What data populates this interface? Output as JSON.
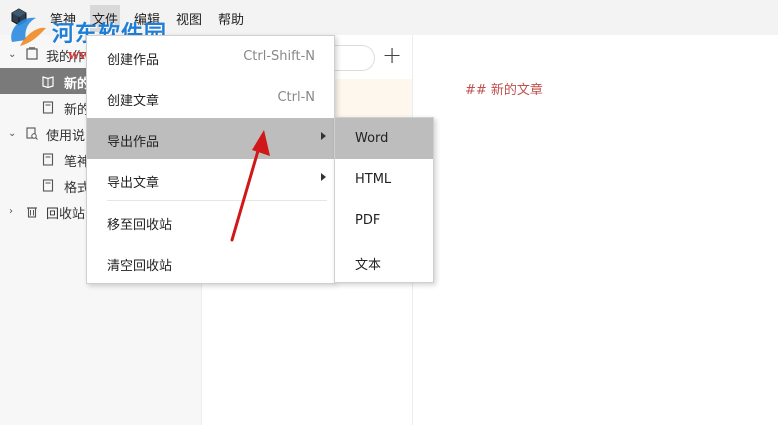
{
  "menubar": {
    "items": [
      {
        "label": "笔神"
      },
      {
        "label": "文件"
      },
      {
        "label": "编辑"
      },
      {
        "label": "视图"
      },
      {
        "label": "帮助"
      }
    ]
  },
  "watermark": {
    "title": "河东软件园",
    "url": "www.pc0359.cn"
  },
  "sidebar": {
    "items": [
      {
        "label": "我的作品",
        "icon": "folder-stack-icon"
      },
      {
        "label": "新的作品",
        "icon": "book-icon"
      },
      {
        "label": "新的文章",
        "icon": "document-icon"
      },
      {
        "label": "使用说明",
        "icon": "search-doc-icon"
      },
      {
        "label": "笔神",
        "icon": "document-icon"
      },
      {
        "label": "格式",
        "icon": "document-icon"
      },
      {
        "label": "回收站",
        "icon": "trash-icon"
      }
    ]
  },
  "editor": {
    "content": "## 新的文章"
  },
  "file_menu": {
    "items": [
      {
        "label": "创建作品",
        "shortcut": "Ctrl-Shift-N"
      },
      {
        "label": "创建文章",
        "shortcut": "Ctrl-N"
      },
      {
        "label": "导出作品",
        "shortcut": ""
      },
      {
        "label": "导出文章",
        "shortcut": ""
      },
      {
        "label": "移至回收站",
        "shortcut": ""
      },
      {
        "label": "清空回收站",
        "shortcut": ""
      }
    ]
  },
  "export_submenu": {
    "items": [
      {
        "label": "Word"
      },
      {
        "label": "HTML"
      },
      {
        "label": "PDF"
      },
      {
        "label": "文本"
      }
    ]
  },
  "colors": {
    "accent_red": "#c0504d",
    "menu_hover": "#bdbdbd",
    "selected_row": "#7a7a7a",
    "watermark_blue": "#1f7fd6"
  }
}
